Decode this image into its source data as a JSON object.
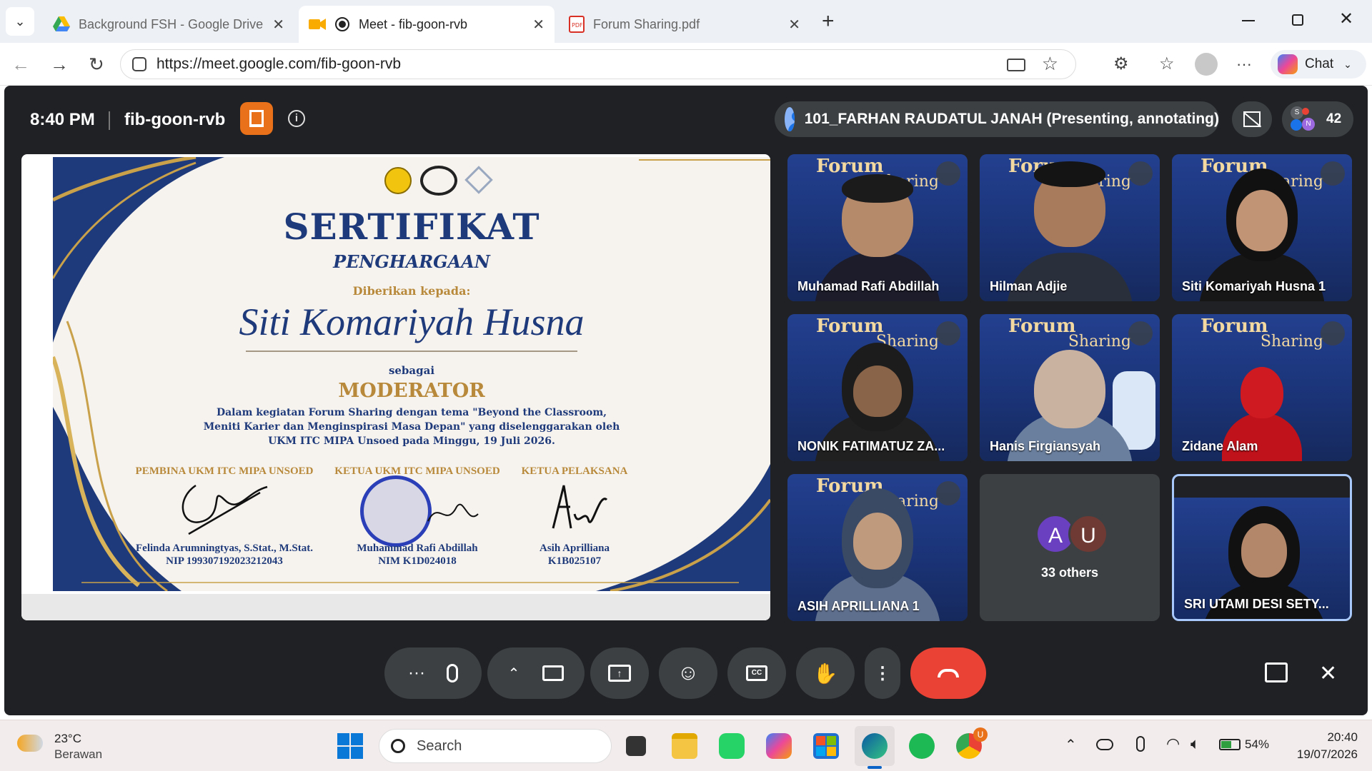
{
  "browser": {
    "tabs": [
      {
        "title": "Background FSH - Google Drive",
        "active": false
      },
      {
        "title": "Meet - fib-goon-rvb",
        "active": true
      },
      {
        "title": "Forum Sharing.pdf",
        "active": false
      }
    ],
    "url": "https://meet.google.com/fib-goon-rvb",
    "chat_label": "Chat"
  },
  "meet": {
    "time": "8:40 PM",
    "meeting_code": "fib-goon-rvb",
    "presenter": "101_FARHAN RAUDATUL JANAH (Presenting, annotating)",
    "participant_count": "42",
    "participant_avatars": [
      "S",
      "N"
    ],
    "participants": [
      {
        "name": "Muhamad Rafi Abdillah",
        "muted": true
      },
      {
        "name": "Hilman Adjie",
        "muted": true
      },
      {
        "name": "Siti Komariyah Husna 1",
        "muted": true
      },
      {
        "name": "NONIK FATIMATUZ ZA...",
        "muted": true
      },
      {
        "name": "Hanis Firgiansyah",
        "muted": true
      },
      {
        "name": "Zidane Alam",
        "muted": true
      },
      {
        "name": "ASIH APRILLIANA 1",
        "muted": true
      },
      {
        "name": "SRI UTAMI DESI SETY...",
        "muted": false
      }
    ],
    "others": {
      "avatars": [
        "A",
        "U"
      ],
      "label": "33 others"
    },
    "tile_background": {
      "forum": "Forum",
      "sharing": "Sharing"
    }
  },
  "certificate": {
    "title": "SERTIFIKAT",
    "subtitle": "PENGHARGAAN",
    "given_to": "Diberikan kepada:",
    "recipient": "Siti Komariyah Husna",
    "as_label": "sebagai",
    "role": "MODERATOR",
    "desc_line1": "Dalam kegiatan Forum Sharing dengan tema \"Beyond the Classroom,",
    "desc_line2": "Meniti Karier dan Menginspirasi Masa Depan\" yang diselenggarakan oleh",
    "desc_line3": "UKM ITC MIPA Unsoed pada Minggu, 19 Juli 2026.",
    "signers": [
      {
        "role": "PEMBINA UKM ITC MIPA UNSOED",
        "name": "Felinda Arumningtyas, S.Stat., M.Stat.",
        "id": "NIP 199307192023212043"
      },
      {
        "role": "KETUA UKM ITC MIPA UNSOED",
        "name": "Muhammad Rafi Abdillah",
        "id": "NIM K1D024018"
      },
      {
        "role": "KETUA PELAKSANA",
        "name": "Asih Aprilliana",
        "id": "K1B025107"
      }
    ]
  },
  "taskbar": {
    "weather_temp": "23°C",
    "weather_desc": "Berawan",
    "search_placeholder": "Search",
    "battery": "54%",
    "time": "20:40",
    "date": "19/07/2026",
    "chrome_badge": "U"
  },
  "colors": {
    "meet_bg": "#202124",
    "end_call": "#ea4335",
    "cert_navy": "#1f3a7a",
    "cert_gold": "#b8893a"
  }
}
